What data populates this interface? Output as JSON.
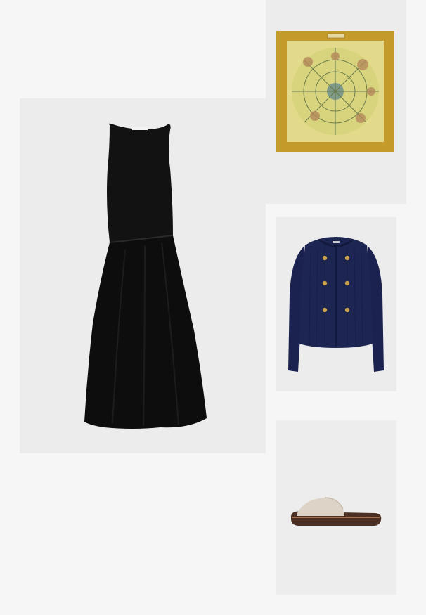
{
  "products": [
    {
      "id": "dress",
      "kind": "black sleeveless drop-waist midi dress",
      "tag_label": ""
    },
    {
      "id": "scarf",
      "kind": "yellow celestial silk scarf"
    },
    {
      "id": "cardigan",
      "kind": "navy double-breasted knit cardigan"
    },
    {
      "id": "sandal",
      "kind": "beige slide sandal"
    }
  ],
  "colors": {
    "page_bg": "#f6f6f6",
    "panel_bg": "#ececec",
    "dress": "#111111",
    "scarf_border": "#c49a2a",
    "scarf_center": "#e6e19a",
    "cardigan": "#1c2450",
    "buttons": "#c9a24a",
    "sandal_strap": "#ddd3c6",
    "sandal_sole": "#4a2f22"
  }
}
